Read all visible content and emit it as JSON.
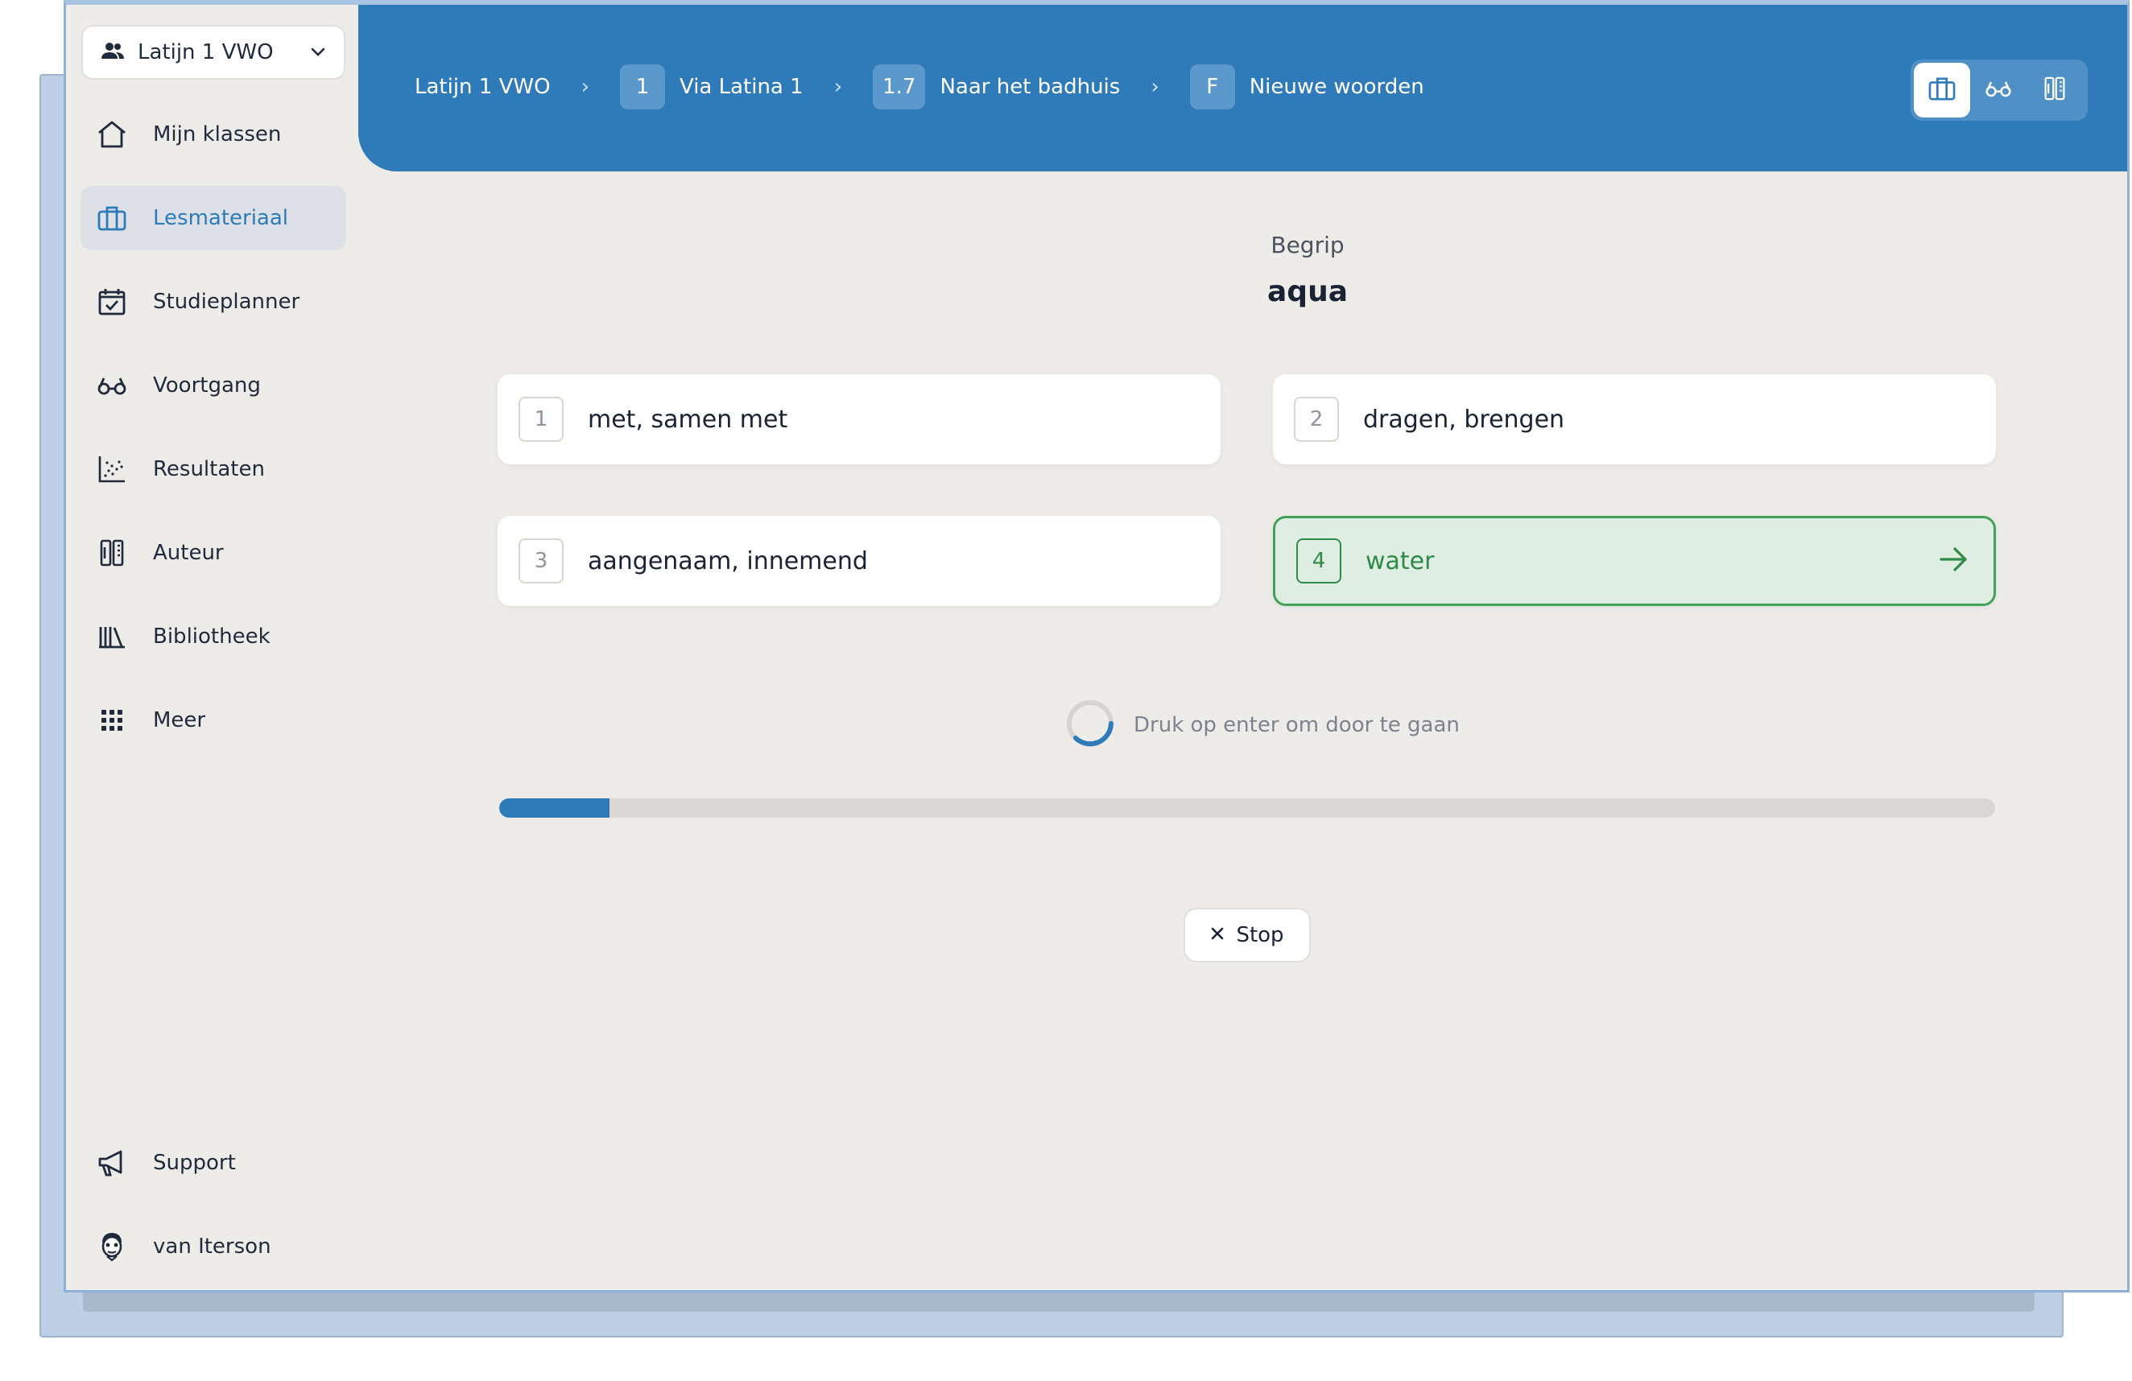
{
  "class_selector": {
    "label": "Latijn 1 VWO"
  },
  "sidebar": {
    "items": [
      {
        "label": "Mijn klassen",
        "icon": "home-icon"
      },
      {
        "label": "Lesmateriaal",
        "icon": "briefcase-icon",
        "active": true
      },
      {
        "label": "Studieplanner",
        "icon": "calendar-check-icon"
      },
      {
        "label": "Voortgang",
        "icon": "glasses-icon"
      },
      {
        "label": "Resultaten",
        "icon": "scatter-chart-icon"
      },
      {
        "label": "Auteur",
        "icon": "author-icon"
      },
      {
        "label": "Bibliotheek",
        "icon": "books-icon"
      },
      {
        "label": "Meer",
        "icon": "grid-icon"
      }
    ],
    "bottom": [
      {
        "label": "Support",
        "icon": "megaphone-icon"
      },
      {
        "label": "van Iterson",
        "icon": "avatar-icon"
      }
    ]
  },
  "breadcrumb": {
    "course": "Latijn 1 VWO",
    "book_num": "1",
    "book": "Via Latina 1",
    "chapter_num": "1.7",
    "chapter": "Naar het badhuis",
    "section_num": "F",
    "section": "Nieuwe woorden"
  },
  "exercise": {
    "term_label": "Begrip",
    "term": "aqua",
    "options": [
      {
        "num": "1",
        "text": "met, samen met"
      },
      {
        "num": "2",
        "text": "dragen, brengen"
      },
      {
        "num": "3",
        "text": "aangenaam, innemend"
      },
      {
        "num": "4",
        "text": "water",
        "correct": true
      }
    ],
    "hint": "Druk op enter om door te gaan",
    "progress": 0.074,
    "stop_label": "Stop"
  },
  "colors": {
    "accent": "#2f7ab8",
    "correct": "#2f8a47",
    "correct_bg": "#dfeee2",
    "background": "#eeece9"
  }
}
